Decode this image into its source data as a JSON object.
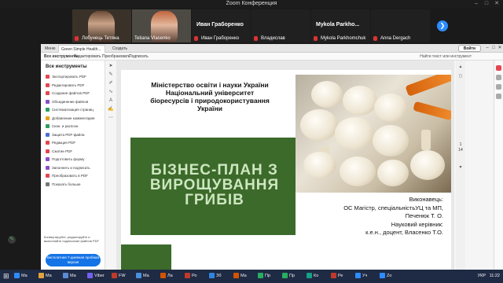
{
  "zoom": {
    "window_title": "Zoom Конференция",
    "participants": [
      {
        "name": "Лобунець Тетяна",
        "has_video": true
      },
      {
        "name": "Tetiana Vlasenko",
        "has_video": true
      },
      {
        "name": "Иван Граборенко",
        "has_video": false
      },
      {
        "name": "Владислав",
        "has_video": false
      },
      {
        "name": "Mykola Parkhomchuk",
        "big_label": "Mykola  Parkho...",
        "has_video": false
      },
      {
        "name": "Anna Dergach",
        "has_video": false
      }
    ],
    "big_label_ivan": "Иван Граборенко",
    "next_arrow": "❯"
  },
  "acrobat": {
    "tabs": [
      "Меню",
      "Green Simple Health...",
      "Создать"
    ],
    "signin_label": "Войти",
    "menu": [
      "Все инструменты",
      "Редактировать",
      "Преобразовать",
      "Подписать"
    ],
    "search_tools": "Найти текст или инструмент",
    "sidebar_title": "Все инструменты",
    "tools": [
      {
        "label": "Экспортировать PDF",
        "color": "#e34850"
      },
      {
        "label": "Редактировать PDF",
        "color": "#e34850"
      },
      {
        "label": "Создание файлов PDF",
        "color": "#e34850"
      },
      {
        "label": "Объединение файлов",
        "color": "#8a4fc7"
      },
      {
        "label": "Систематизация страниц",
        "color": "#2e9e5e"
      },
      {
        "label": "Добавление комментария",
        "color": "#e8a21b"
      },
      {
        "label": "Скан. и распозн.",
        "color": "#2e9e5e"
      },
      {
        "label": "Защита PDF-файла",
        "color": "#4d6bd8"
      },
      {
        "label": "Редакция PDF",
        "color": "#e34850"
      },
      {
        "label": "Сжатие PDF",
        "color": "#e34850"
      },
      {
        "label": "Подготовить форму",
        "color": "#8a4fc7"
      },
      {
        "label": "Заполнить и подписать",
        "color": "#8a4fc7"
      },
      {
        "label": "Преобразовать в PDF",
        "color": "#e34850"
      },
      {
        "label": "Показать больше",
        "color": "#777777"
      }
    ],
    "promo_text": "Конвертируйте, редактируйте и выполняйте подписание файлов PDF",
    "trial_button": "Бесплатная 7-дневная пробная версия",
    "page_num": "1",
    "page_total": "14"
  },
  "slide": {
    "institution_lines": [
      "Міністерство освіти і науки України",
      "Національний університет",
      "біоресурсів і природокористування",
      "України"
    ],
    "title_lines": [
      "БІЗНЕС-ПЛАН З",
      "ВИРОЩУВАННЯ",
      "ГРИБІВ"
    ],
    "credit_lines": [
      "Виконавець:",
      "ОС Магістр, спеціальністьУЦ та МП,",
      "Печенюк Т. О.",
      "Науковий керівник:",
      "к.е.н., доцент, Власенко Т.О."
    ]
  },
  "taskbar": {
    "items": [
      {
        "label": "Ma",
        "color": "#2d8cff"
      },
      {
        "label": "Ma",
        "color": "#e1a23a"
      },
      {
        "label": "Ma",
        "color": "#5b8ad6"
      },
      {
        "label": "Viber",
        "color": "#7360f2"
      },
      {
        "label": "FW",
        "color": "#c0392b"
      },
      {
        "label": "Ma",
        "color": "#4a8fdb"
      },
      {
        "label": "Ла",
        "color": "#d35400"
      },
      {
        "label": "Ро",
        "color": "#c0392b"
      },
      {
        "label": "Зб",
        "color": "#2e86de"
      },
      {
        "label": "Ма",
        "color": "#d35400"
      },
      {
        "label": "Пр",
        "color": "#27ae60"
      },
      {
        "label": "Пр",
        "color": "#27ae60"
      },
      {
        "label": "Ко",
        "color": "#16a085"
      },
      {
        "label": "Ре",
        "color": "#c0392b"
      },
      {
        "label": "Уч",
        "color": "#2d8cff"
      },
      {
        "label": "Zo",
        "color": "#2d8cff"
      }
    ],
    "lang": "УКР",
    "time": "11:22"
  }
}
